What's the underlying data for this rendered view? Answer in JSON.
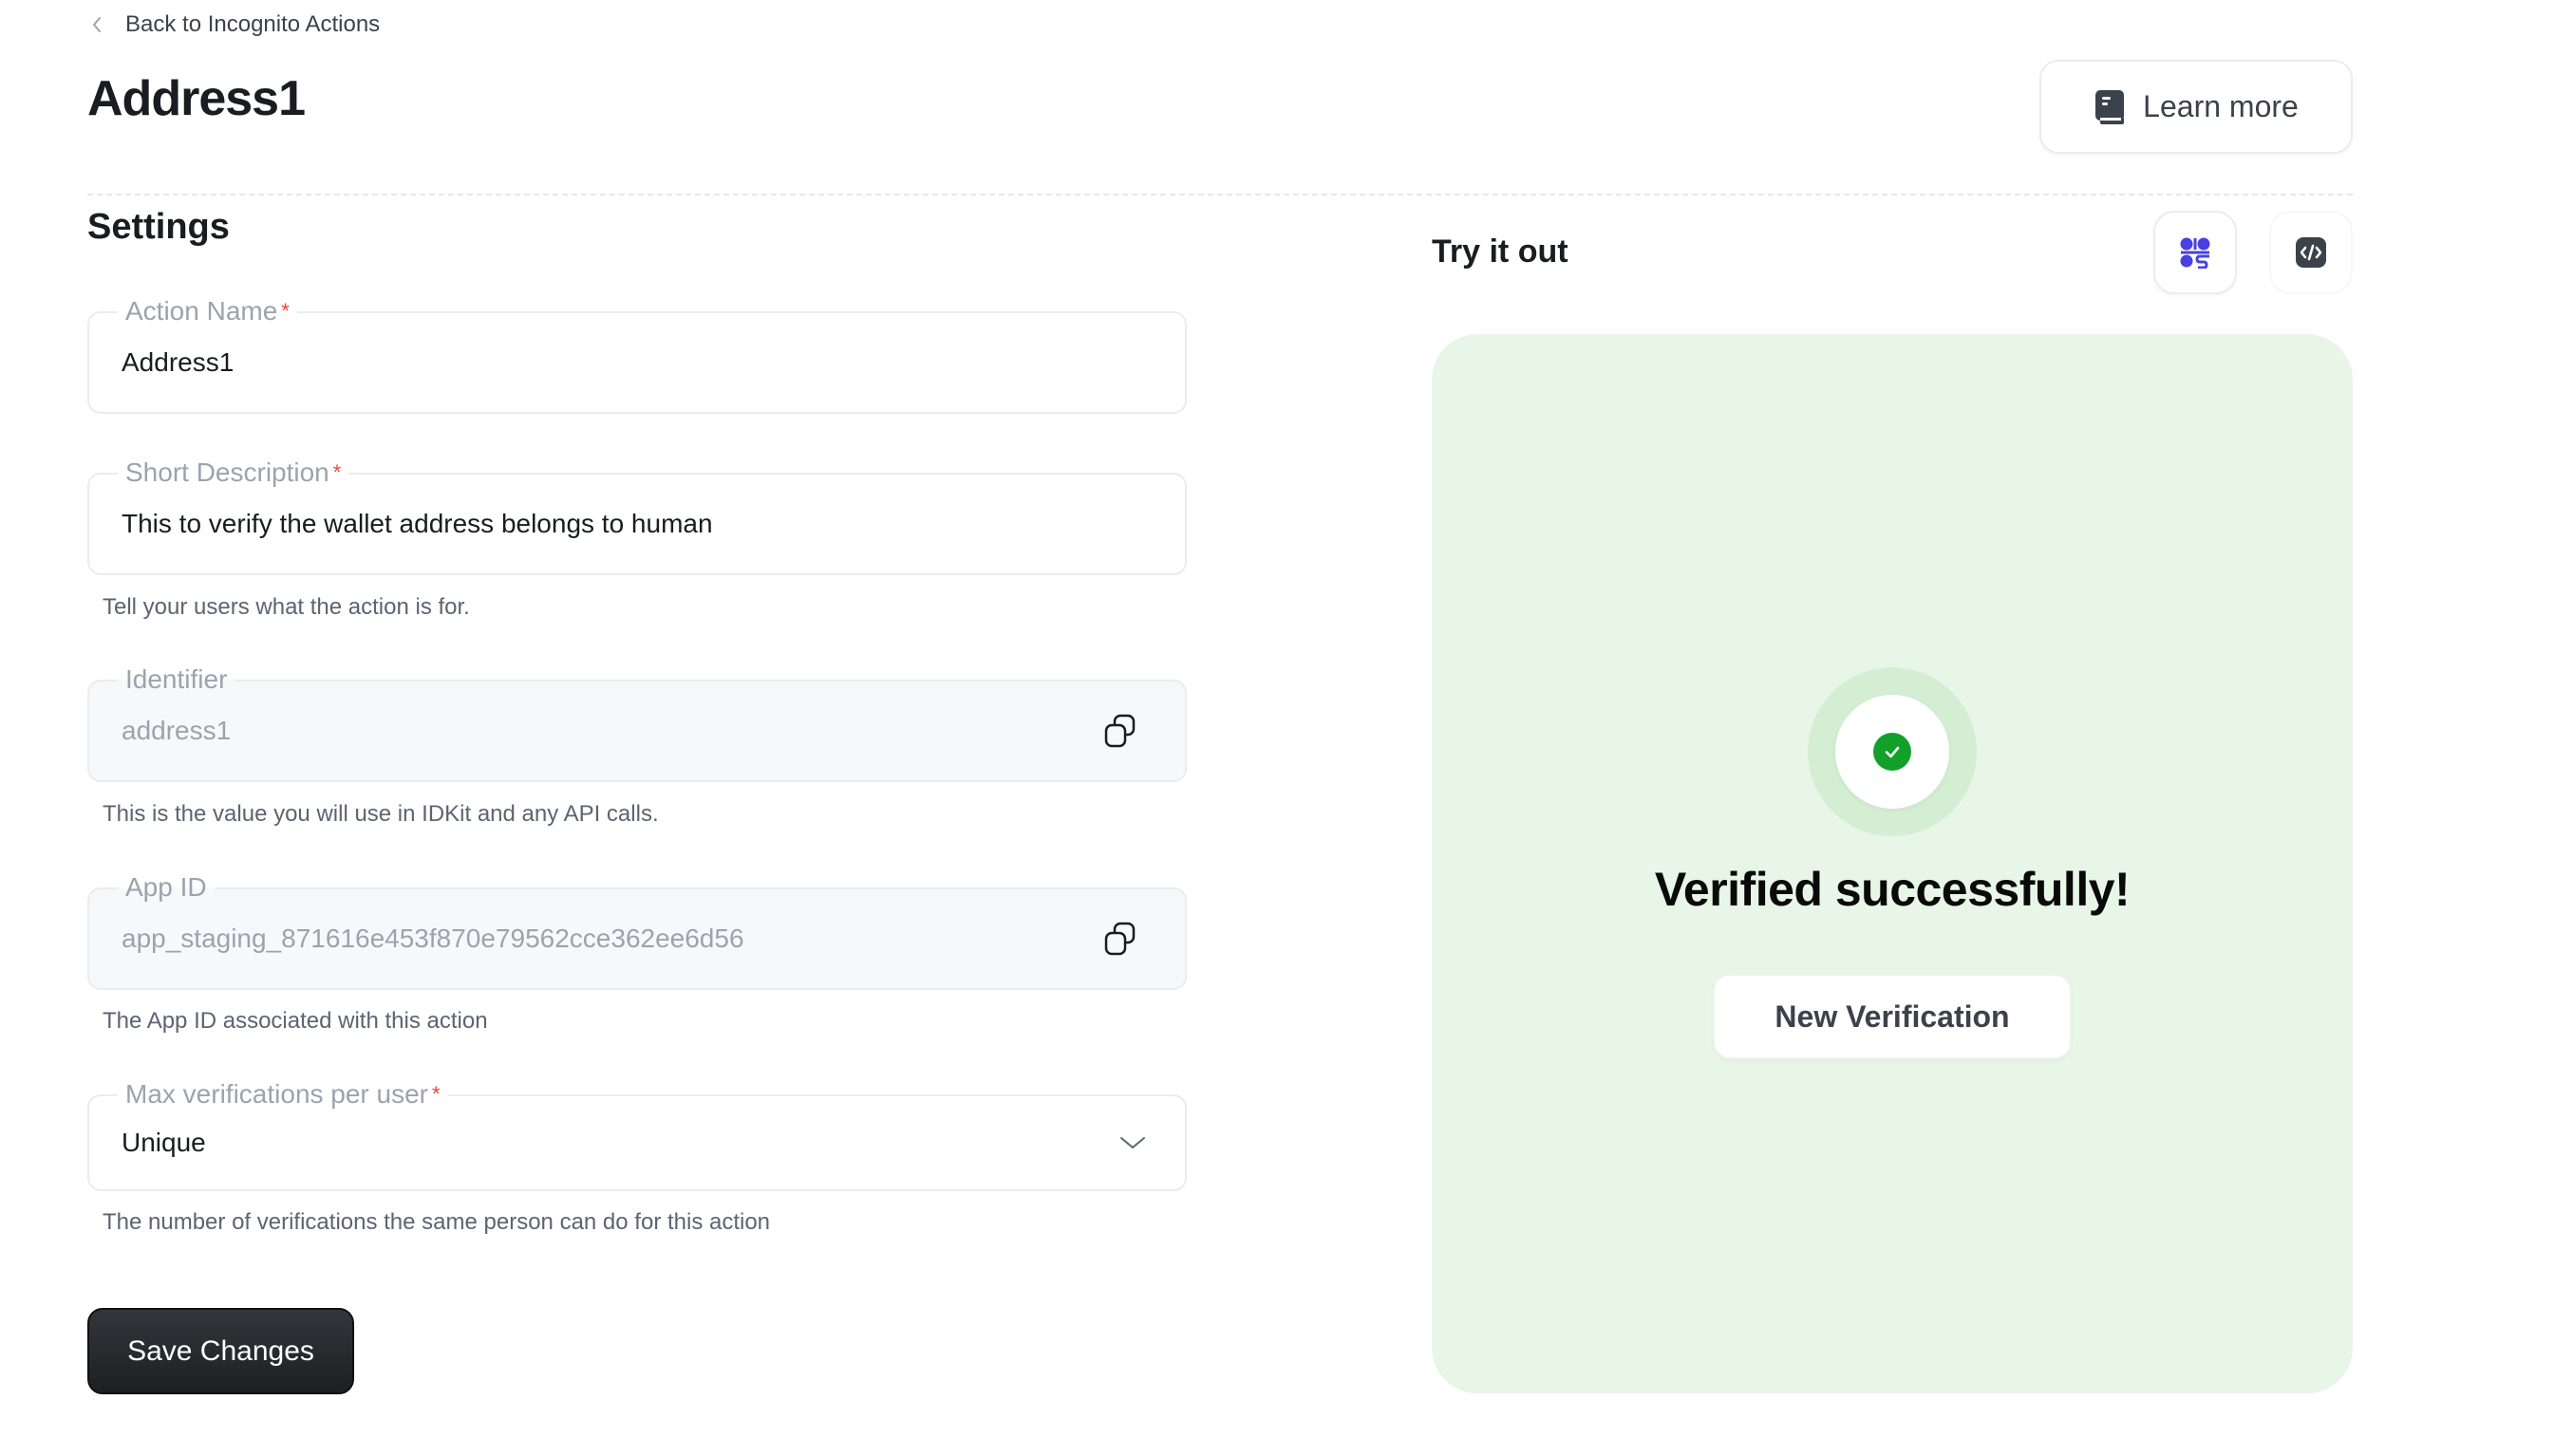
{
  "nav": {
    "back_label": "Back to Incognito Actions",
    "back_icon": "chevron-left-icon"
  },
  "header": {
    "title": "Address1",
    "learn_more_label": "Learn more",
    "learn_more_icon": "book-icon"
  },
  "settings": {
    "heading": "Settings",
    "fields": {
      "action_name": {
        "label": "Action Name",
        "required": "*",
        "value": "Address1"
      },
      "short_description": {
        "label": "Short Description",
        "required": "*",
        "value": "This to verify the wallet address belongs to human",
        "hint": "Tell your users what the action is for."
      },
      "identifier": {
        "label": "Identifier",
        "value": "address1",
        "hint": "This is the value you will use in IDKit and any API calls.",
        "icon": "copy-icon"
      },
      "app_id": {
        "label": "App ID",
        "value": "app_staging_871616e453f870e79562cce362ee6d56",
        "hint": "The App ID associated with this action",
        "icon": "copy-icon"
      },
      "max_verifications": {
        "label": "Max verifications per user",
        "required": "*",
        "value": "Unique",
        "hint": "The number of verifications the same person can do for this action",
        "icon": "chevron-down-icon"
      }
    },
    "save_label": "Save Changes"
  },
  "try_it_out": {
    "title": "Try it out",
    "modes": [
      {
        "name": "app-mode",
        "icon": "qr-app-icon",
        "active": true
      },
      {
        "name": "code-mode",
        "icon": "code-icon",
        "active": false
      }
    ],
    "status_icon": "check-circle-icon",
    "status_text": "Verified successfully!",
    "new_verification_label": "New Verification"
  },
  "colors": {
    "panel_bg": "#e8f6e8",
    "success": "#12a02a",
    "accent": "#4940e0",
    "required": "#f04438",
    "primary_button": "#1e1f23"
  }
}
